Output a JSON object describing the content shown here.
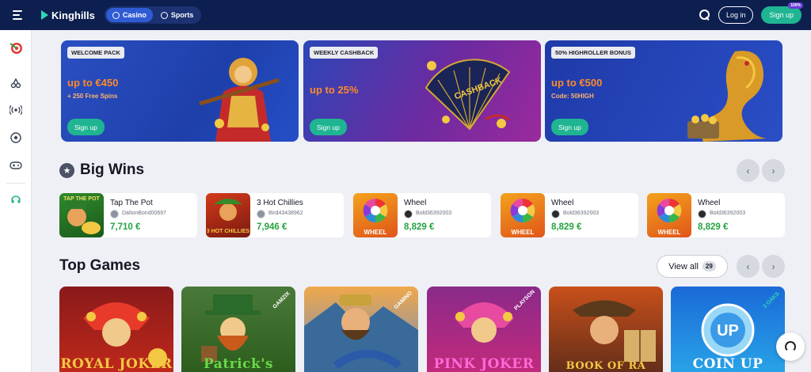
{
  "header": {
    "logo_text": "Kinghills",
    "modes": [
      {
        "label": "Casino",
        "active": true
      },
      {
        "label": "Sports",
        "active": false
      }
    ],
    "login_label": "Log in",
    "signup_label": "Sign up",
    "signup_badge": "100%"
  },
  "sidebar": {
    "icons": [
      "target-icon",
      "cherries-icon",
      "live-broadcast-icon",
      "soccer-ball-icon",
      "gamepad-icon",
      "headset-icon"
    ]
  },
  "banners": [
    {
      "tag": "WELCOME PACK",
      "headline": "up to €450",
      "subline": "+ 250 Free Spins",
      "button": "Sign up"
    },
    {
      "tag": "WEEKLY CASHBACK",
      "headline": "up to 25%",
      "subline": "",
      "button": "Sign up",
      "art_text": "CASHBACK"
    },
    {
      "tag": "50% HIGHROLLER BONUS",
      "headline": "up to €500",
      "subline": "Code: 50HIGH",
      "button": "Sign up"
    }
  ],
  "big_wins": {
    "title": "Big Wins",
    "items": [
      {
        "game": "Tap The Pot",
        "user": "DaltonBond00697",
        "amount": "7,710 €",
        "thumb_text": "TAP THE POT"
      },
      {
        "game": "3 Hot Chillies",
        "user": "Bird43438962",
        "amount": "7,946 €",
        "thumb_text": "3 HOT CHILLIES"
      },
      {
        "game": "Wheel",
        "user": "Bold36392003",
        "amount": "8,829 €",
        "thumb_text": "WHEEL"
      },
      {
        "game": "Wheel",
        "user": "Bold36392003",
        "amount": "8,829 €",
        "thumb_text": "WHEEL"
      },
      {
        "game": "Wheel",
        "user": "Bold36392003",
        "amount": "8,829 €",
        "thumb_text": "WHEEL"
      }
    ]
  },
  "top_games": {
    "title": "Top Games",
    "view_all_label": "View all",
    "count": "29",
    "tiles": [
      {
        "name": "ROYAL JOKER",
        "provider": ""
      },
      {
        "name": "Patrick's",
        "provider": "GAMZIX"
      },
      {
        "name": "",
        "provider": "GAMINO"
      },
      {
        "name": "PINK JOKER",
        "provider": "PLAYSON"
      },
      {
        "name": "BOOK OF RA",
        "provider": ""
      },
      {
        "name": "COIN UP",
        "provider": "3 OAKS"
      }
    ]
  }
}
